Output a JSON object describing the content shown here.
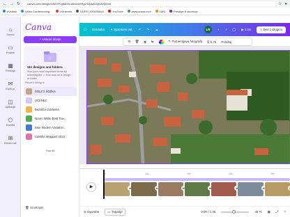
{
  "browser": {
    "url": "canva.com/design/DAGYP1jB6D5/u5eM4tXRg2TQvwG5jVVI/Q/edit",
    "bookmarks": [
      "eVedski",
      "Video Conferencing...",
      "eDnevnik",
      "DDFE | ERASMUS",
      "YouTube",
      "www.unina.com",
      "LMS",
      "Prestige 8 zbornica"
    ]
  },
  "rail": [
    {
      "icon": "⌂",
      "label": "Domov"
    },
    {
      "icon": "▭",
      "label": "Projekti"
    },
    {
      "icon": "▦",
      "label": "Predloge"
    },
    {
      "icon": "✉",
      "label": "Kupni pr."
    },
    {
      "icon": "◫",
      "label": "Aplikacije"
    },
    {
      "icon": "⬡",
      "label": "Znamka"
    },
    {
      "icon": "⊞",
      "label": "Dream Lab"
    }
  ],
  "panel": {
    "logo": "Canva",
    "create_label": "+ Ustvari dizajn",
    "folder_title": "Ste designs and folders",
    "folder_desc": "Star your most important items by selecting the ☆ icon now on a design or folder.",
    "recent_label": "Recent designs",
    "recent": [
      {
        "label": "ŠOLZ 2 ŠOŽKA",
        "color": "#c1a77e",
        "active": true
      },
      {
        "label": "UČENEC",
        "color": "#d6c9f6",
        "active": false
      },
      {
        "label": "Bazaščo izdelavka",
        "color": "#f4b63f",
        "active": false
      },
      {
        "label": "Green White Bold Trav...",
        "color": "#4caf50",
        "active": false
      },
      {
        "label": "Blue Modern Vacation...",
        "color": "#3d7bd8",
        "active": false
      },
      {
        "label": "Colorful Wrapped 2023...",
        "color": "#e86fb1",
        "active": false
      }
    ],
    "see_all": "See all",
    "trash": "Smetnjak"
  },
  "toolbar": {
    "file": "Datoteka",
    "resize": "Spremeni vel.",
    "avatar": "LR",
    "time": "1:16",
    "share": "Deli z drugimi"
  },
  "context": {
    "edit_photo": "Pomemljava fotografij",
    "duration": "6,75",
    "position": "Položaj"
  },
  "timeline": {
    "ruler": [
      "0s",
      "10s",
      "15s",
      "20s",
      "25s"
    ],
    "clips": [
      "#b8a272",
      "#7d6a4a",
      "#9a7b62",
      "#5f7a44",
      "#a25a4c",
      "#7c8c9a",
      "#b89a64"
    ]
  },
  "bottombar": {
    "notes": "Opombe",
    "timeline_btn": "Trajanje",
    "time": "0:00 / 1:46",
    "zoom": "46 %"
  }
}
